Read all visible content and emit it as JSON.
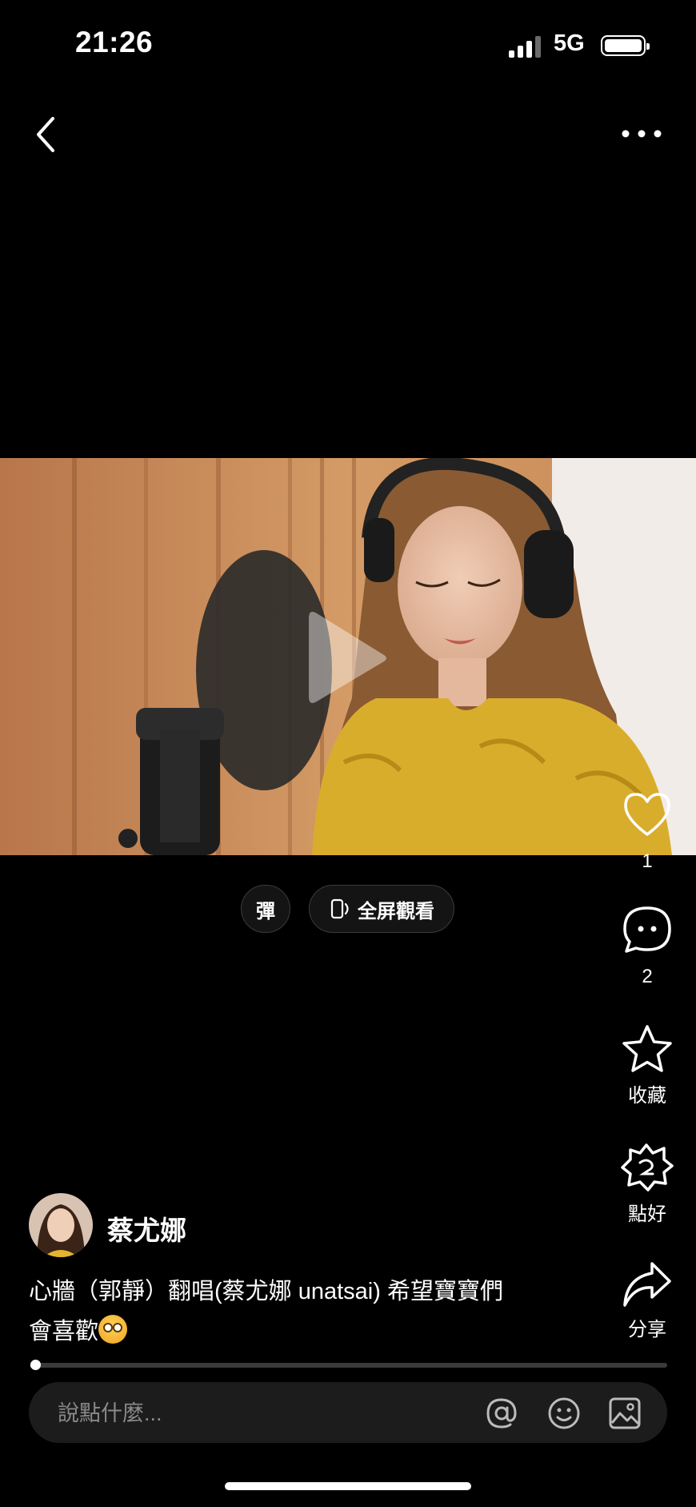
{
  "status_bar": {
    "time": "21:26",
    "network": "5G"
  },
  "nav": {
    "back_icon": "chevron-left-icon",
    "more_icon": "more-horizontal-icon"
  },
  "video": {
    "state": "paused"
  },
  "pills": {
    "danmu_label": "彈",
    "fullscreen_label": "全屏觀看"
  },
  "actions": {
    "like_count": "1",
    "comment_count": "2",
    "favorite_label": "收藏",
    "good_label": "點好",
    "share_label": "分享"
  },
  "author": {
    "name": "蔡尤娜"
  },
  "caption": {
    "line1": "心牆（郭靜）翻唱(蔡尤娜 unatsai) 希望寶寶們",
    "line2": "會喜歡"
  },
  "progress": {
    "fraction": 0.005
  },
  "comment": {
    "placeholder": "說點什麼..."
  },
  "colors": {
    "background": "#000000",
    "accent": "#ffffff",
    "shirt_yellow": "#d9ad2c"
  }
}
